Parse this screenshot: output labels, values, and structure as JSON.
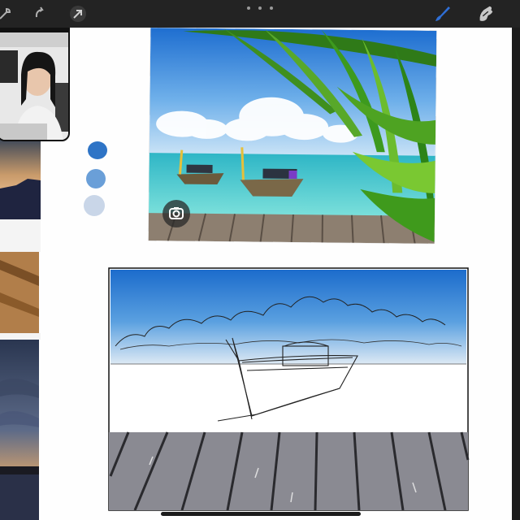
{
  "toolbar": {
    "left_icons": [
      "settings-wrench-icon",
      "adjustments-wand-icon",
      "selection-icon",
      "transform-arrow-icon"
    ],
    "more_icon": "more-dots-icon",
    "right_icons": [
      "brush-icon",
      "smudge-icon"
    ],
    "accent_color": "#2f6fd6"
  },
  "swatches": [
    "#2e74c6",
    "#6a9fd8",
    "#c9d6e8"
  ],
  "reference_photo": {
    "description_icon": "lens-search-icon"
  },
  "video_overlay": {
    "present": true
  },
  "colors": {
    "sky_top": "#1b6fcc",
    "sky_bottom": "#dbe9f5",
    "dock": "#8a8a92",
    "toolbar_bg": "#232323"
  }
}
